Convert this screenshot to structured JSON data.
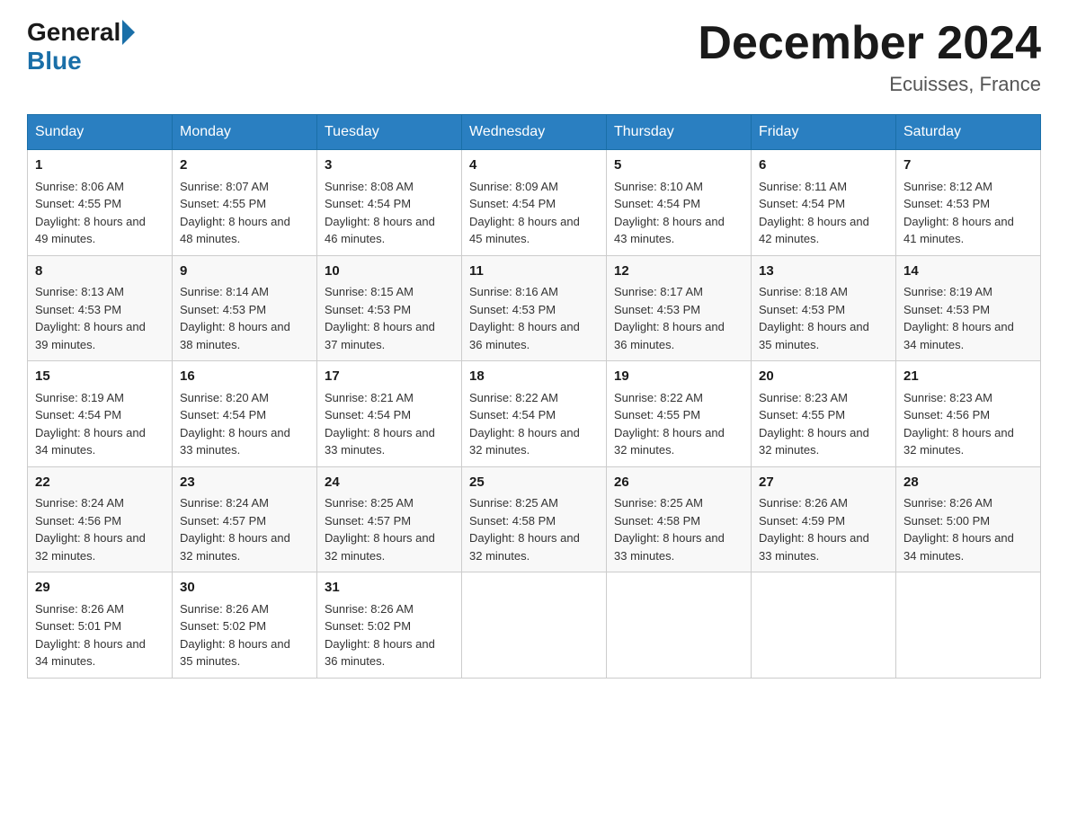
{
  "header": {
    "logo_general": "General",
    "logo_blue": "Blue",
    "month_title": "December 2024",
    "location": "Ecuisses, France"
  },
  "calendar": {
    "days_of_week": [
      "Sunday",
      "Monday",
      "Tuesday",
      "Wednesday",
      "Thursday",
      "Friday",
      "Saturday"
    ],
    "weeks": [
      [
        {
          "day": "1",
          "sunrise": "8:06 AM",
          "sunset": "4:55 PM",
          "daylight": "8 hours and 49 minutes."
        },
        {
          "day": "2",
          "sunrise": "8:07 AM",
          "sunset": "4:55 PM",
          "daylight": "8 hours and 48 minutes."
        },
        {
          "day": "3",
          "sunrise": "8:08 AM",
          "sunset": "4:54 PM",
          "daylight": "8 hours and 46 minutes."
        },
        {
          "day": "4",
          "sunrise": "8:09 AM",
          "sunset": "4:54 PM",
          "daylight": "8 hours and 45 minutes."
        },
        {
          "day": "5",
          "sunrise": "8:10 AM",
          "sunset": "4:54 PM",
          "daylight": "8 hours and 43 minutes."
        },
        {
          "day": "6",
          "sunrise": "8:11 AM",
          "sunset": "4:54 PM",
          "daylight": "8 hours and 42 minutes."
        },
        {
          "day": "7",
          "sunrise": "8:12 AM",
          "sunset": "4:53 PM",
          "daylight": "8 hours and 41 minutes."
        }
      ],
      [
        {
          "day": "8",
          "sunrise": "8:13 AM",
          "sunset": "4:53 PM",
          "daylight": "8 hours and 39 minutes."
        },
        {
          "day": "9",
          "sunrise": "8:14 AM",
          "sunset": "4:53 PM",
          "daylight": "8 hours and 38 minutes."
        },
        {
          "day": "10",
          "sunrise": "8:15 AM",
          "sunset": "4:53 PM",
          "daylight": "8 hours and 37 minutes."
        },
        {
          "day": "11",
          "sunrise": "8:16 AM",
          "sunset": "4:53 PM",
          "daylight": "8 hours and 36 minutes."
        },
        {
          "day": "12",
          "sunrise": "8:17 AM",
          "sunset": "4:53 PM",
          "daylight": "8 hours and 36 minutes."
        },
        {
          "day": "13",
          "sunrise": "8:18 AM",
          "sunset": "4:53 PM",
          "daylight": "8 hours and 35 minutes."
        },
        {
          "day": "14",
          "sunrise": "8:19 AM",
          "sunset": "4:53 PM",
          "daylight": "8 hours and 34 minutes."
        }
      ],
      [
        {
          "day": "15",
          "sunrise": "8:19 AM",
          "sunset": "4:54 PM",
          "daylight": "8 hours and 34 minutes."
        },
        {
          "day": "16",
          "sunrise": "8:20 AM",
          "sunset": "4:54 PM",
          "daylight": "8 hours and 33 minutes."
        },
        {
          "day": "17",
          "sunrise": "8:21 AM",
          "sunset": "4:54 PM",
          "daylight": "8 hours and 33 minutes."
        },
        {
          "day": "18",
          "sunrise": "8:22 AM",
          "sunset": "4:54 PM",
          "daylight": "8 hours and 32 minutes."
        },
        {
          "day": "19",
          "sunrise": "8:22 AM",
          "sunset": "4:55 PM",
          "daylight": "8 hours and 32 minutes."
        },
        {
          "day": "20",
          "sunrise": "8:23 AM",
          "sunset": "4:55 PM",
          "daylight": "8 hours and 32 minutes."
        },
        {
          "day": "21",
          "sunrise": "8:23 AM",
          "sunset": "4:56 PM",
          "daylight": "8 hours and 32 minutes."
        }
      ],
      [
        {
          "day": "22",
          "sunrise": "8:24 AM",
          "sunset": "4:56 PM",
          "daylight": "8 hours and 32 minutes."
        },
        {
          "day": "23",
          "sunrise": "8:24 AM",
          "sunset": "4:57 PM",
          "daylight": "8 hours and 32 minutes."
        },
        {
          "day": "24",
          "sunrise": "8:25 AM",
          "sunset": "4:57 PM",
          "daylight": "8 hours and 32 minutes."
        },
        {
          "day": "25",
          "sunrise": "8:25 AM",
          "sunset": "4:58 PM",
          "daylight": "8 hours and 32 minutes."
        },
        {
          "day": "26",
          "sunrise": "8:25 AM",
          "sunset": "4:58 PM",
          "daylight": "8 hours and 33 minutes."
        },
        {
          "day": "27",
          "sunrise": "8:26 AM",
          "sunset": "4:59 PM",
          "daylight": "8 hours and 33 minutes."
        },
        {
          "day": "28",
          "sunrise": "8:26 AM",
          "sunset": "5:00 PM",
          "daylight": "8 hours and 34 minutes."
        }
      ],
      [
        {
          "day": "29",
          "sunrise": "8:26 AM",
          "sunset": "5:01 PM",
          "daylight": "8 hours and 34 minutes."
        },
        {
          "day": "30",
          "sunrise": "8:26 AM",
          "sunset": "5:02 PM",
          "daylight": "8 hours and 35 minutes."
        },
        {
          "day": "31",
          "sunrise": "8:26 AM",
          "sunset": "5:02 PM",
          "daylight": "8 hours and 36 minutes."
        },
        null,
        null,
        null,
        null
      ]
    ]
  }
}
